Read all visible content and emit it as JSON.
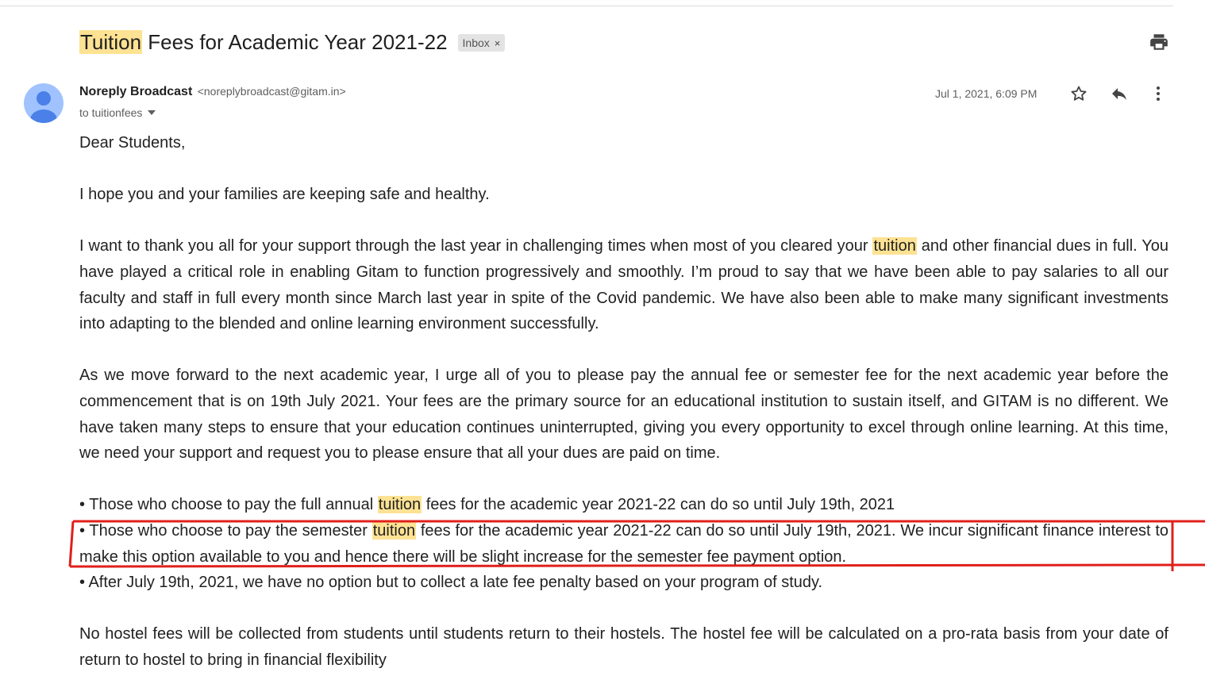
{
  "subject": {
    "highlight": "Tuition",
    "rest": " Fees for Academic Year 2021-22",
    "label": "Inbox",
    "label_close": "×"
  },
  "icons": {
    "print": "print-icon",
    "avatar": "person-avatar-icon",
    "star": "star-icon",
    "reply": "reply-icon",
    "more": "more-vert-icon",
    "expand": "caret-down-icon"
  },
  "sender": {
    "name": "Noreply Broadcast",
    "email": "<noreplybroadcast@gitam.in>",
    "to": "to tuitionfees",
    "date": "Jul 1, 2021, 6:09 PM"
  },
  "body": {
    "greeting": "Dear Students,",
    "p1": "I hope you and your families are keeping safe and healthy.",
    "p2_a": "I want to thank you all for your support through the last year in challenging times when most of you cleared your ",
    "p2_hl": "tuition",
    "p2_b": " and other financial dues in full. You have played a critical role in enabling Gitam to function progressively and smoothly. I’m proud to say that we have been able to pay salaries to all our faculty and staff in full every month since March last year in spite of the Covid pandemic. We have also been able to make many significant investments into adapting to the blended and online learning environment successfully.",
    "p3": "As we move forward to the next academic year, I urge all of you to please pay the annual fee or semester fee for the next academic year before the commencement that is on 19th July 2021. Your fees are the primary source for an educational institution to sustain itself, and GITAM is no different. We have taken many steps to ensure that your education continues uninterrupted, giving you every opportunity to excel through online learning. At this time, we need your support and request you to please ensure that all your dues are paid on time.",
    "b1_a": "• Those who choose to pay the full annual ",
    "b1_hl": "tuition",
    "b1_b": " fees for the academic year 2021-22 can do so until July 19th, 2021",
    "b2_a": "• Those who choose to pay the semester ",
    "b2_hl": "tuition",
    "b2_b": " fees for the academic year 2021-22 can do so until July 19th, 2021. We incur significant finance interest to make this option available to you and hence there will be slight increase for the semester fee payment option.",
    "b3": "• After July 19th, 2021,  we have no option but to collect a late fee penalty based on your program of study.",
    "p4": "No hostel fees will be collected from students until students return to their hostels. The hostel fee will be calculated on a pro-rata basis from your date of return to hostel to bring in financial flexibility"
  },
  "colors": {
    "highlight": "#fde293",
    "annotation": "#e0201b",
    "avatar_bg": "#a0c3ff",
    "avatar_fg": "#4a80e8"
  }
}
